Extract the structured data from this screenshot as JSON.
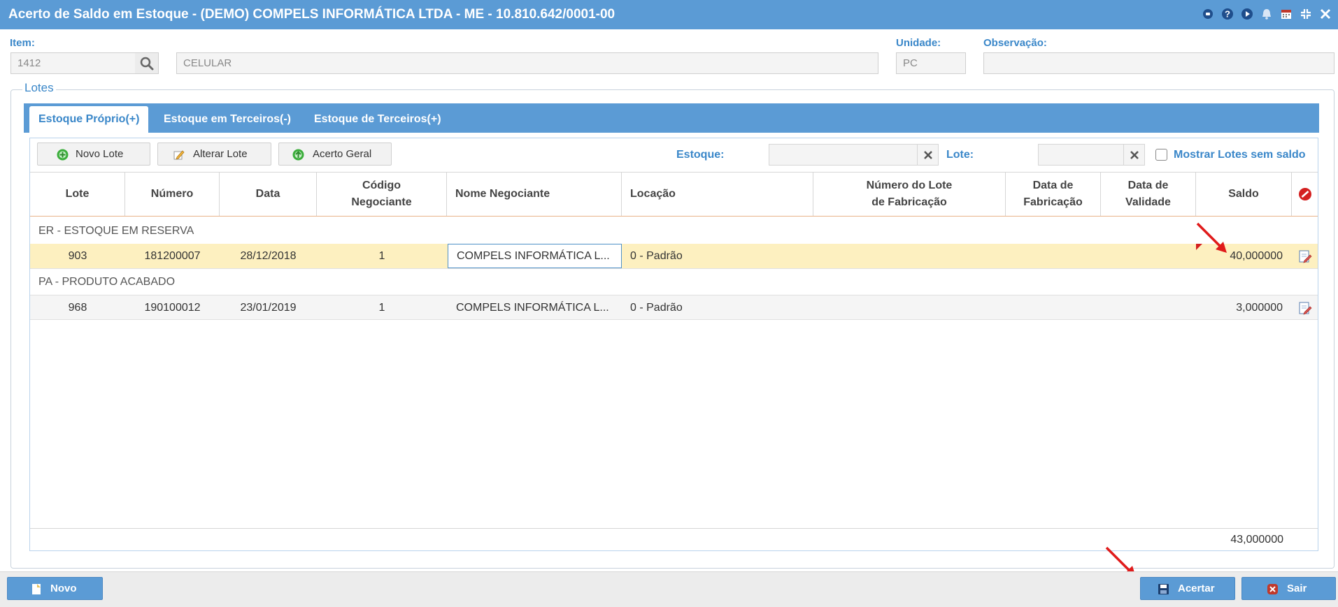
{
  "window": {
    "title": "Acerto de Saldo em Estoque - (DEMO) COMPELS INFORMÁTICA LTDA - ME - 10.810.642/0001-00",
    "tool_icons": [
      "record-icon",
      "help-icon",
      "play-icon",
      "bell-icon",
      "calendar-icon",
      "collapse-icon",
      "close-icon"
    ]
  },
  "header": {
    "item_label": "Item:",
    "item_code": "1412",
    "item_description": "CELULAR",
    "unidade_label": "Unidade:",
    "unidade_value": "PC",
    "observacao_label": "Observação:",
    "observacao_value": ""
  },
  "lotes": {
    "legend": "Lotes",
    "tabs": [
      {
        "label": "Estoque Próprio(+)",
        "active": true
      },
      {
        "label": "Estoque em Terceiros(-)",
        "active": false
      },
      {
        "label": "Estoque de Terceiros(+)",
        "active": false
      }
    ],
    "toolbar": {
      "novo_lote": "Novo Lote",
      "alterar_lote": "Alterar Lote",
      "acerto_geral": "Acerto Geral",
      "estoque_label": "Estoque:",
      "estoque_value": "",
      "lote_label": "Lote:",
      "lote_value": "",
      "mostrar_label": "Mostrar Lotes sem saldo"
    },
    "columns": {
      "lote": "Lote",
      "numero": "Número",
      "data": "Data",
      "codigo_l1": "Código",
      "codigo_l2": "Negociante",
      "nome": "Nome Negociante",
      "locacao": "Locação",
      "num_lote_l1": "Número do Lote",
      "num_lote_l2": "de Fabricação",
      "data_fab_l1": "Data de",
      "data_fab_l2": "Fabricação",
      "data_val_l1": "Data de",
      "data_val_l2": "Validade",
      "saldo": "Saldo"
    },
    "groups": [
      {
        "name": "ER - ESTOQUE EM RESERVA",
        "rows": [
          {
            "lote": "903",
            "numero": "181200007",
            "data": "28/12/2018",
            "codigo": "1",
            "nome": "COMPELS INFORMÁTICA L...",
            "locacao": "0 - Padrão",
            "num_lote_fab": "",
            "data_fab": "",
            "data_val": "",
            "saldo": "40,000000"
          }
        ]
      },
      {
        "name": "PA - PRODUTO ACABADO",
        "rows": [
          {
            "lote": "968",
            "numero": "190100012",
            "data": "23/01/2019",
            "codigo": "1",
            "nome": "COMPELS INFORMÁTICA L...",
            "locacao": "0 - Padrão",
            "num_lote_fab": "",
            "data_fab": "",
            "data_val": "",
            "saldo": "3,000000"
          }
        ]
      }
    ],
    "total_saldo": "43,000000"
  },
  "bottom": {
    "novo": "Novo",
    "acertar": "Acertar",
    "sair": "Sair"
  },
  "colors": {
    "accent": "#5b9bd5",
    "label_blue": "#3a87c9",
    "selected_row": "#fdf0c0",
    "annotation_arrow": "#e01b1b"
  }
}
